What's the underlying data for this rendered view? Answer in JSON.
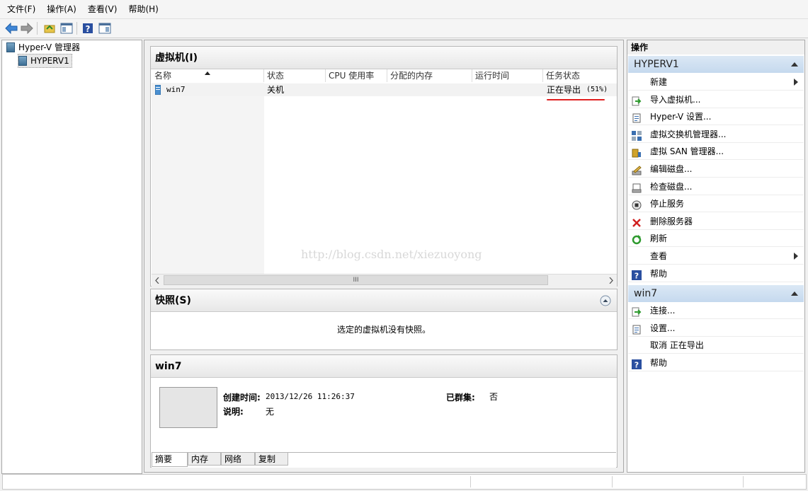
{
  "menu": [
    "文件(F)",
    "操作(A)",
    "查看(V)",
    "帮助(H)"
  ],
  "tree": {
    "root": "Hyper-V 管理器",
    "child": "HYPERV1"
  },
  "vm_panel": {
    "title": "虚拟机(I)",
    "columns": [
      "名称",
      "状态",
      "CPU 使用率",
      "分配的内存",
      "运行时间",
      "任务状态"
    ],
    "rows": [
      {
        "name": "win7",
        "state": "关机",
        "cpu": "",
        "memory": "",
        "uptime": "",
        "task": "正在导出",
        "task_percent": "(51%)"
      }
    ],
    "watermark": "http://blog.csdn.net/xiezuoyong",
    "scroll_grip": "III"
  },
  "snapshot_panel": {
    "title": "快照(S)",
    "empty_text": "选定的虚拟机没有快照。"
  },
  "details_panel": {
    "title": "win7",
    "created_label": "创建时间:",
    "created_value": "2013/12/26 11:26:37",
    "clustered_label": "已群集:",
    "clustered_value": "否",
    "desc_label": "说明:",
    "desc_value": "无",
    "tabs": [
      "摘要",
      "内存",
      "网络",
      "复制"
    ]
  },
  "actions": {
    "title": "操作",
    "server_section": "HYPERV1",
    "server_items": [
      {
        "label": "新建",
        "icon": "blank",
        "submenu": true
      },
      {
        "label": "导入虚拟机...",
        "icon": "import-icon"
      },
      {
        "label": "Hyper-V 设置...",
        "icon": "settings-doc-icon"
      },
      {
        "label": "虚拟交换机管理器...",
        "icon": "switch-icon"
      },
      {
        "label": "虚拟 SAN 管理器...",
        "icon": "san-icon"
      },
      {
        "label": "编辑磁盘...",
        "icon": "edit-disk-icon"
      },
      {
        "label": "检查磁盘...",
        "icon": "inspect-disk-icon"
      },
      {
        "label": "停止服务",
        "icon": "stop-icon"
      },
      {
        "label": "删除服务器",
        "icon": "delete-icon"
      },
      {
        "label": "刷新",
        "icon": "refresh-icon"
      },
      {
        "label": "查看",
        "icon": "blank",
        "submenu": true
      },
      {
        "label": "帮助",
        "icon": "help-icon"
      }
    ],
    "vm_section": "win7",
    "vm_items": [
      {
        "label": "连接...",
        "icon": "connect-icon"
      },
      {
        "label": "设置...",
        "icon": "settings-doc-icon"
      },
      {
        "label": "取消 正在导出",
        "icon": "blank"
      },
      {
        "label": "帮助",
        "icon": "help-icon"
      }
    ]
  },
  "colors": {
    "section_header": "#c5d9ee",
    "underline_red": "#e02020"
  }
}
